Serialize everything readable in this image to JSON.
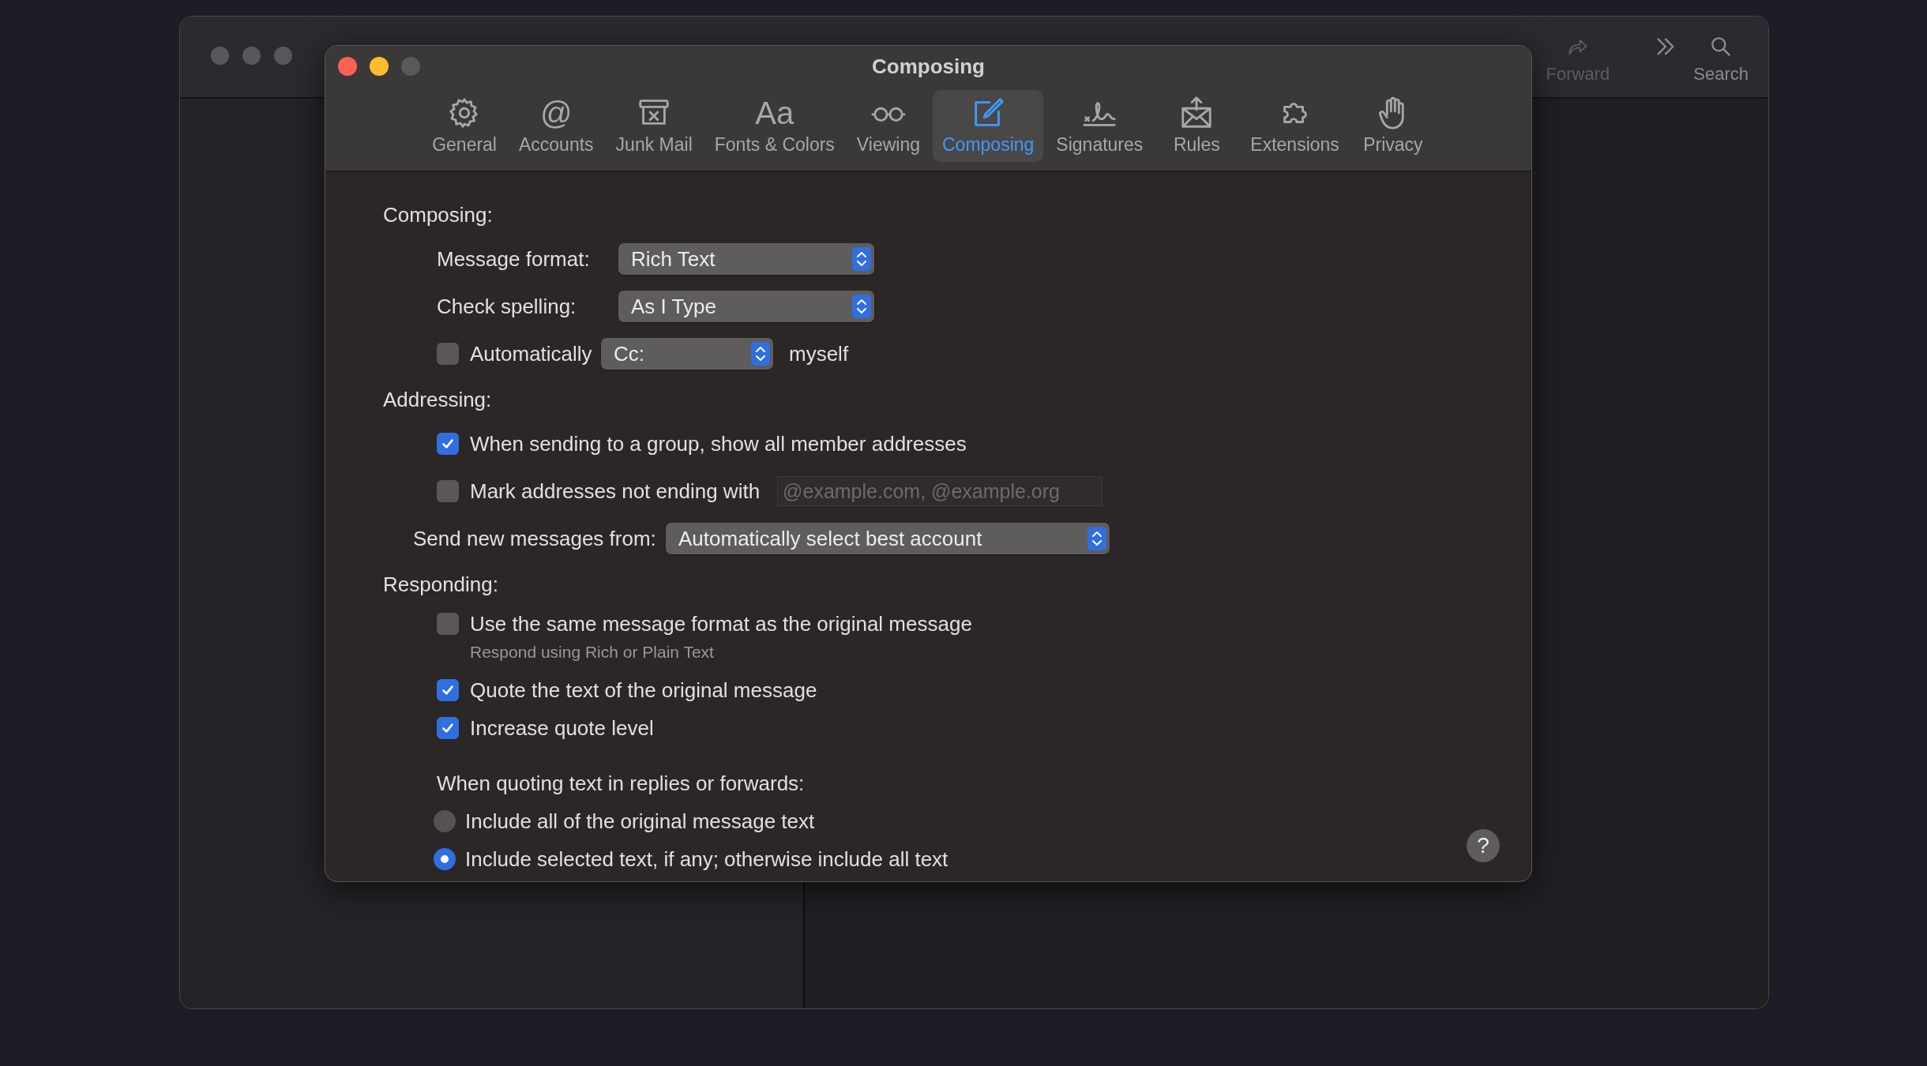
{
  "background_window": {
    "toolbar": [
      {
        "label": "Forward",
        "disabled": true
      },
      {
        "label": "Search",
        "disabled": false
      }
    ]
  },
  "window": {
    "title": "Composing",
    "help": "?"
  },
  "tabs": [
    {
      "label": "General",
      "selected": false
    },
    {
      "label": "Accounts",
      "glyph": "@",
      "selected": false
    },
    {
      "label": "Junk Mail",
      "selected": false
    },
    {
      "label": "Fonts & Colors",
      "glyph": "Aa",
      "selected": false
    },
    {
      "label": "Viewing",
      "selected": false
    },
    {
      "label": "Composing",
      "selected": true
    },
    {
      "label": "Signatures",
      "selected": false
    },
    {
      "label": "Rules",
      "selected": false
    },
    {
      "label": "Extensions",
      "selected": false
    },
    {
      "label": "Privacy",
      "selected": false
    }
  ],
  "sections": [
    {
      "title": "Composing:",
      "rows": [
        {
          "kind": "popup",
          "label": "Message format:",
          "value": "Rich Text"
        },
        {
          "kind": "popup",
          "label": "Check spelling:",
          "value": "As I Type"
        },
        {
          "kind": "checkbox_popup",
          "label": "Automatically",
          "checked": false,
          "value": "Cc:",
          "suffix": "myself"
        }
      ]
    },
    {
      "title": "Addressing:",
      "rows": [
        {
          "kind": "checkbox",
          "label": "When sending to a group, show all member addresses",
          "checked": true
        },
        {
          "kind": "checkbox_field",
          "label": "Mark addresses not ending with",
          "checked": false,
          "placeholder": "@example.com, @example.org"
        },
        {
          "kind": "popup_wide",
          "label": "Send new messages from:",
          "value": "Automatically select best account"
        }
      ]
    },
    {
      "title": "Responding:",
      "rows": [
        {
          "kind": "checkbox",
          "label": "Use the same message format as the original message",
          "checked": false,
          "note": "Respond using Rich or Plain Text"
        },
        {
          "kind": "checkbox",
          "label": "Quote the text of the original message",
          "checked": true
        },
        {
          "kind": "checkbox",
          "label": "Increase quote level",
          "checked": true
        },
        {
          "kind": "heading",
          "label": "When quoting text in replies or forwards:"
        },
        {
          "kind": "radio",
          "label": "Include all of the original message text",
          "selected": false
        },
        {
          "kind": "radio",
          "label": "Include selected text, if any; otherwise include all text",
          "selected": true
        }
      ]
    }
  ]
}
